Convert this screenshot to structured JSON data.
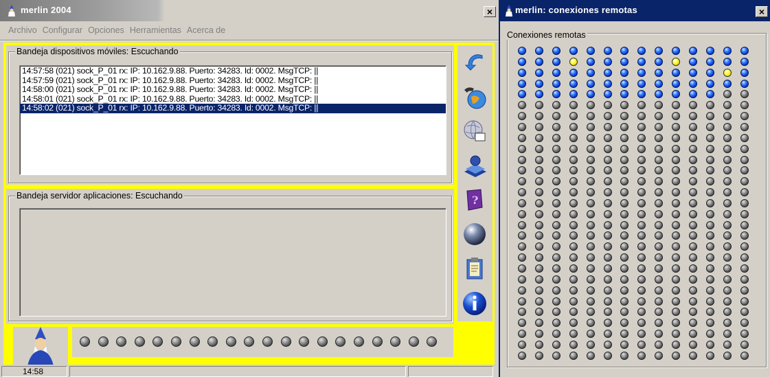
{
  "main_window": {
    "title": "merlin 2004",
    "close_label": "×",
    "menu": [
      "Archivo",
      "Configurar",
      "Opciones",
      "Herramientas",
      "Acerca de"
    ],
    "mobile_tray": {
      "label": "Bandeja dispositivos móviles: Escuchando",
      "log": [
        "14:57:58 (021) sock_P_01 rx: IP: 10.162.9.88. Puerto: 34283. Id: 0002. MsgTCP: ||",
        "14:57:59 (021) sock_P_01 rx: IP: 10.162.9.88. Puerto: 34283. Id: 0002. MsgTCP: ||",
        "14:58:00 (021) sock_P_01 rx: IP: 10.162.9.88. Puerto: 34283. Id: 0002. MsgTCP: ||",
        "14:58:01 (021) sock_P_01 rx: IP: 10.162.9.88. Puerto: 34283. Id: 0002. MsgTCP: ||",
        "14:58:02 (021) sock_P_01 rx: IP: 10.162.9.88. Puerto: 34283. Id: 0002. MsgTCP: ||"
      ],
      "selected_index": 4
    },
    "app_server_tray": {
      "label": "Bandeja servidor aplicaciones: Escuchando"
    },
    "toolbar_icons": [
      "refresh-arrow-icon",
      "phone-globe-icon",
      "globe-window-icon",
      "network-computer-icon",
      "help-book-icon",
      "sphere-icon",
      "clipboard-icon",
      "info-icon"
    ],
    "led_count": 20,
    "status": {
      "time": "14:58"
    }
  },
  "remote_window": {
    "title": "merlin: conexiones remotas",
    "close_label": "×",
    "group_label": "Conexiones remotas",
    "grid": {
      "columns": 14,
      "rows": 29,
      "active_blue": 68,
      "yellow_indices": [
        17,
        23,
        40
      ]
    }
  },
  "colors": {
    "accent_yellow": "#ffff00",
    "title_active": "#0a246a",
    "face": "#d4d0c8",
    "led_blue": "#0033cc",
    "led_grey": "#4a4a4a"
  }
}
